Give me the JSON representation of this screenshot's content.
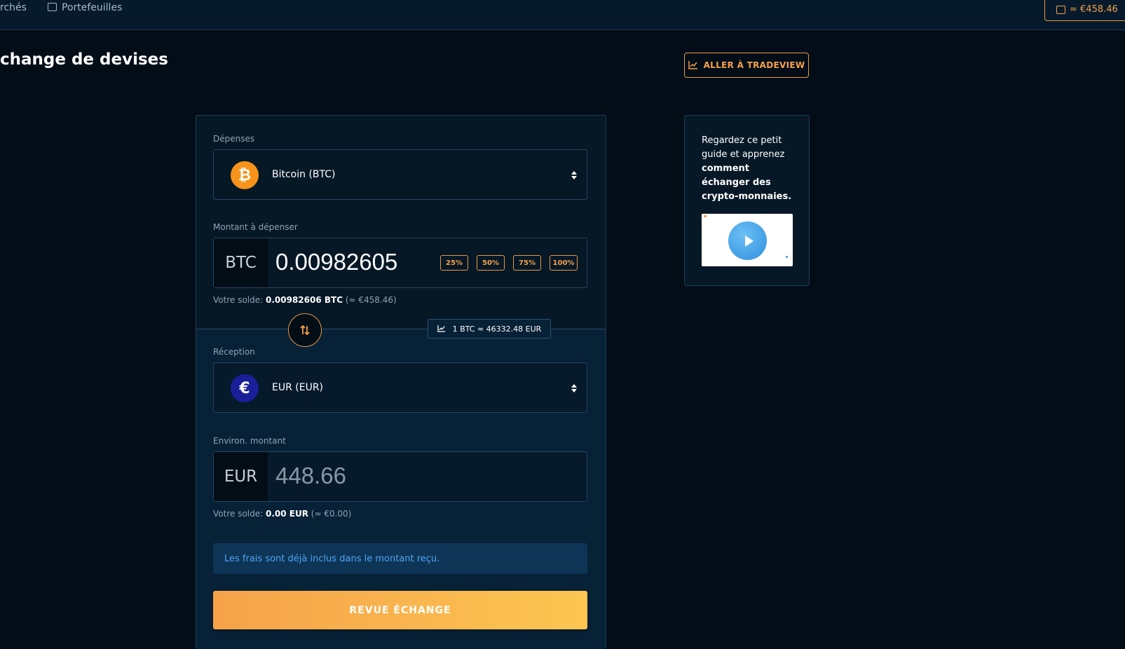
{
  "nav": {
    "markets_label": "rchés",
    "wallets_label": "Portefeuilles",
    "wallet_balance": "≈ €458.46"
  },
  "page": {
    "title": "change de devises",
    "tradeview_label": "ALLER À TRADEVIEW"
  },
  "spend": {
    "label": "Dépenses",
    "currency": "Bitcoin (BTC)",
    "icon": "bitcoin-icon"
  },
  "amount_spend": {
    "label": "Montant à dépenser",
    "code": "BTC",
    "value": "0.00982605",
    "percent_options": [
      "25%",
      "50%",
      "75%",
      "100%"
    ],
    "balance_prefix": "Votre solde: ",
    "balance_value": "0.00982606 BTC",
    "balance_approx": " (≈ €458.46)"
  },
  "rate": {
    "text": "1 BTC ≈ 46332.48 EUR"
  },
  "receive": {
    "label": "Réception",
    "currency": "EUR (EUR)",
    "icon": "euro-icon"
  },
  "amount_receive": {
    "label": "Environ. montant",
    "code": "EUR",
    "value": "448.66",
    "balance_prefix": "Votre solde: ",
    "balance_value": "0.00 EUR",
    "balance_approx": " (≈ €0.00)"
  },
  "fees_note": "Les frais sont déjà inclus dans le montant reçu.",
  "review_button": "REVUE ÉCHANGE",
  "guide": {
    "text_plain": "Regardez ce petit guide et apprenez ",
    "text_bold": "comment échanger des crypto-monnaies."
  },
  "colors": {
    "accent": "#f4a24c",
    "background": "#020d17",
    "info_text": "#4ea3f5"
  }
}
